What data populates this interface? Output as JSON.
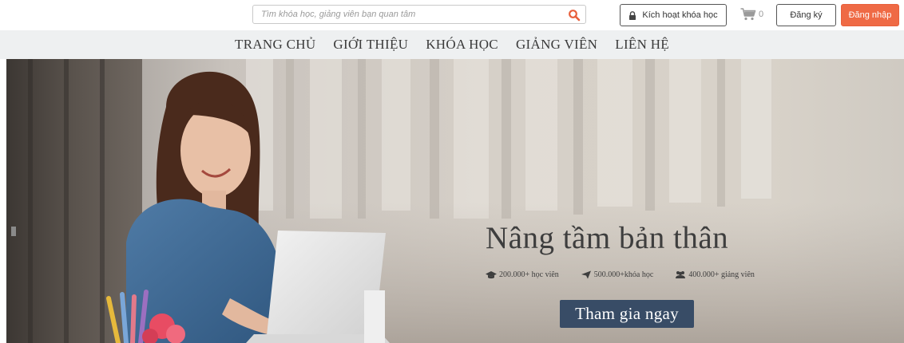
{
  "header": {
    "search": {
      "placeholder": "Tìm khóa học, giảng viên bạn quan tâm",
      "value": "",
      "icon": "search-icon"
    },
    "activate_label": "Kích hoạt khóa học",
    "cart_count": "0",
    "register_label": "Đăng ký",
    "login_label": "Đăng nhập"
  },
  "nav": {
    "items": [
      {
        "label": "TRANG CHỦ"
      },
      {
        "label": "GIỚI THIỆU"
      },
      {
        "label": "KHÓA HỌC"
      },
      {
        "label": "GIẢNG VIÊN"
      },
      {
        "label": "LIÊN HỆ"
      }
    ]
  },
  "hero": {
    "title": "Nâng tầm bản thân",
    "stats": [
      {
        "icon": "graduation-cap-icon",
        "text": "200.000+ học viên"
      },
      {
        "icon": "paper-plane-icon",
        "text": "500.000+khóa học"
      },
      {
        "icon": "users-icon",
        "text": "400.000+ giảng viên"
      }
    ],
    "cta_label": "Tham gia ngay"
  },
  "colors": {
    "accent": "#ef6a45",
    "cta_bg": "#384c66",
    "search_icon": "#e8603c",
    "nav_bg": "#eef0f1"
  }
}
